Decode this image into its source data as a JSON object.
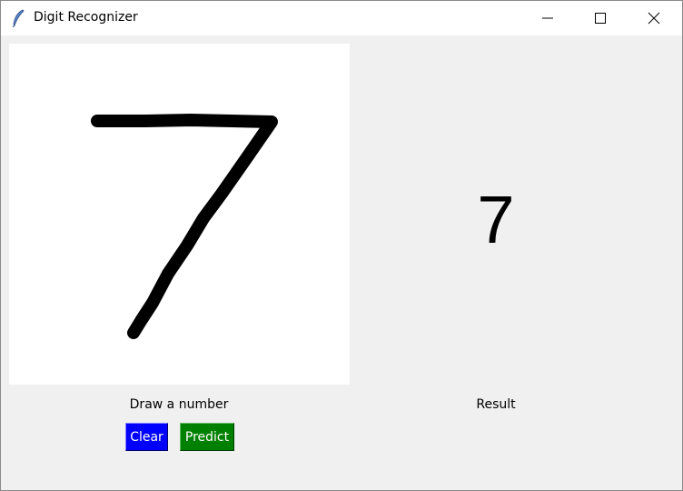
{
  "window": {
    "title": "Digit Recognizer",
    "app_icon": "feather-icon"
  },
  "window_controls": [
    "minimize-icon",
    "maximize-icon",
    "close-icon"
  ],
  "canvas": {
    "background": "#ffffff",
    "stroke_color": "#000000",
    "drawn_digit": "7"
  },
  "labels": {
    "draw": "Draw a number",
    "result": "Result"
  },
  "result": {
    "value": "7"
  },
  "buttons": {
    "clear": {
      "label": "Clear",
      "color": "#0000ff"
    },
    "predict": {
      "label": "Predict",
      "color": "#008000"
    }
  }
}
